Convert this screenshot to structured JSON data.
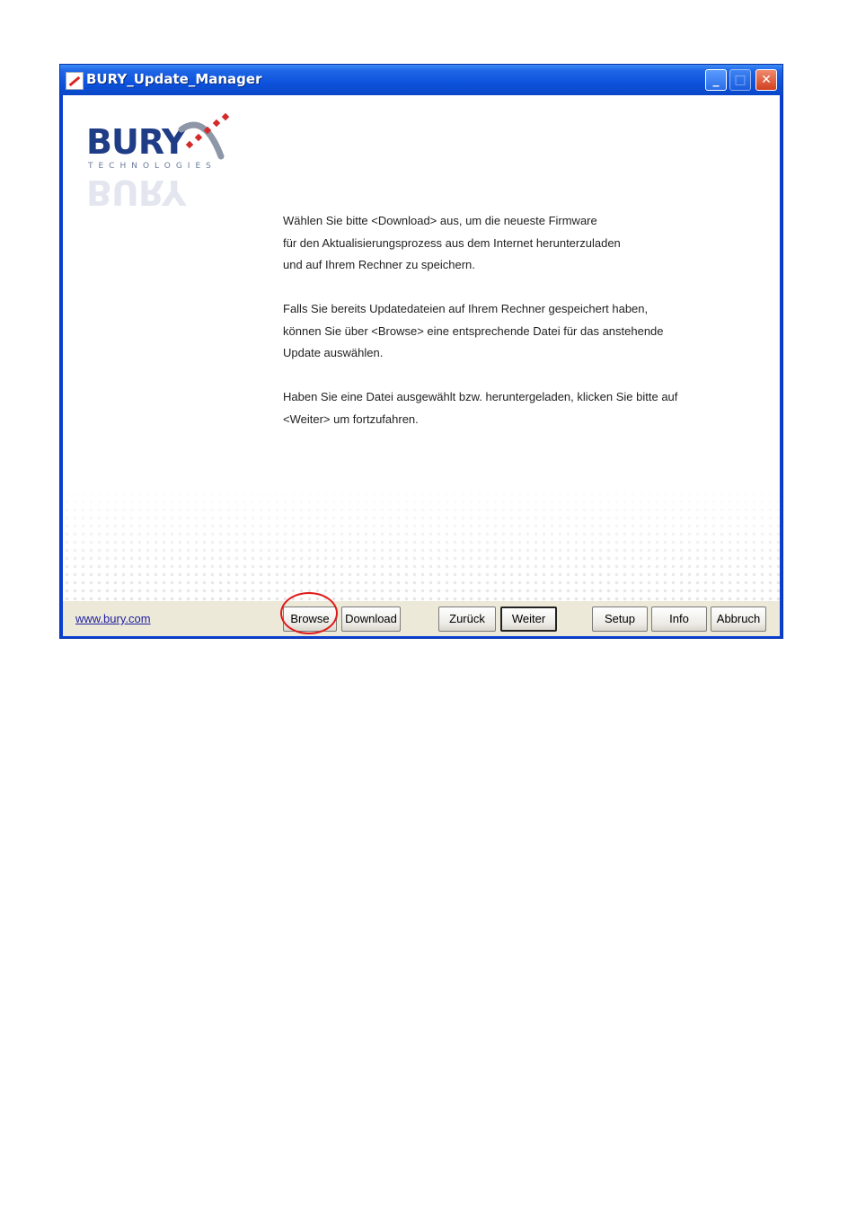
{
  "window": {
    "title": "BURY_Update_Manager",
    "controls": {
      "minimize": "_",
      "maximize": "□",
      "close": "✕"
    }
  },
  "logo": {
    "brand": "BURY",
    "tagline": "TECHNOLOGIES"
  },
  "message": {
    "paragraphs": [
      [
        "Wählen Sie bitte <Download> aus, um die neueste Firmware",
        "für den Aktualisierungsprozess aus dem Internet herunterzuladen",
        "und auf Ihrem Rechner zu speichern."
      ],
      [
        "Falls Sie bereits Updatedateien auf Ihrem Rechner gespeichert haben,",
        "können Sie über <Browse> eine entsprechende Datei für das anstehende",
        "Update auswählen."
      ],
      [
        "Haben Sie eine Datei ausgewählt bzw. heruntergeladen, klicken Sie bitte auf",
        "<Weiter> um fortzufahren."
      ]
    ]
  },
  "footer": {
    "link": "www.bury.com",
    "buttons": {
      "browse": "Browse",
      "download": "Download",
      "back": "Zurück",
      "next": "Weiter",
      "setup": "Setup",
      "info": "Info",
      "cancel": "Abbruch"
    }
  },
  "colors": {
    "title_bar": "#0c52dc",
    "annotation": "#e01818",
    "brand": "#1f3c86",
    "brand_accent": "#d42a2a"
  }
}
